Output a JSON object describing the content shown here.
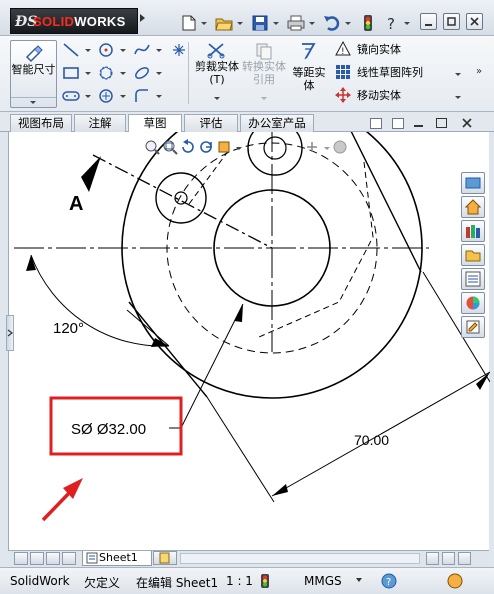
{
  "app": {
    "brand_prefix": "SOLID",
    "brand_suffix": "WORKS"
  },
  "command_manager": {
    "smart_dimension": "智能尺寸",
    "trim_entities": "剪裁实体",
    "trim_entities_shortcut": "(T)",
    "convert_entities": "转换实体引用",
    "offset_entities": "等距实体",
    "mirror_entities": "镜向实体",
    "linear_pattern": "线性草图阵列",
    "move_entities": "移动实体"
  },
  "tabs": [
    {
      "label": "视图布局",
      "active": false
    },
    {
      "label": "注解",
      "active": false
    },
    {
      "label": "草图",
      "active": true
    },
    {
      "label": "评估",
      "active": false
    },
    {
      "label": "办公室产品",
      "active": false
    }
  ],
  "drawing": {
    "section_label": "A",
    "angle_label": "120°",
    "diameter_label": "SØ Ø32.00",
    "linear_label": "70.00",
    "highlight_color": "#e02020",
    "line_color": "#000000"
  },
  "sheet": {
    "tab_label": "Sheet1"
  },
  "status": {
    "app_name": "SolidWork",
    "definition": "欠定义",
    "editing": "在编辑 Sheet1",
    "scale": "1 : 1",
    "units": "MMGS"
  }
}
